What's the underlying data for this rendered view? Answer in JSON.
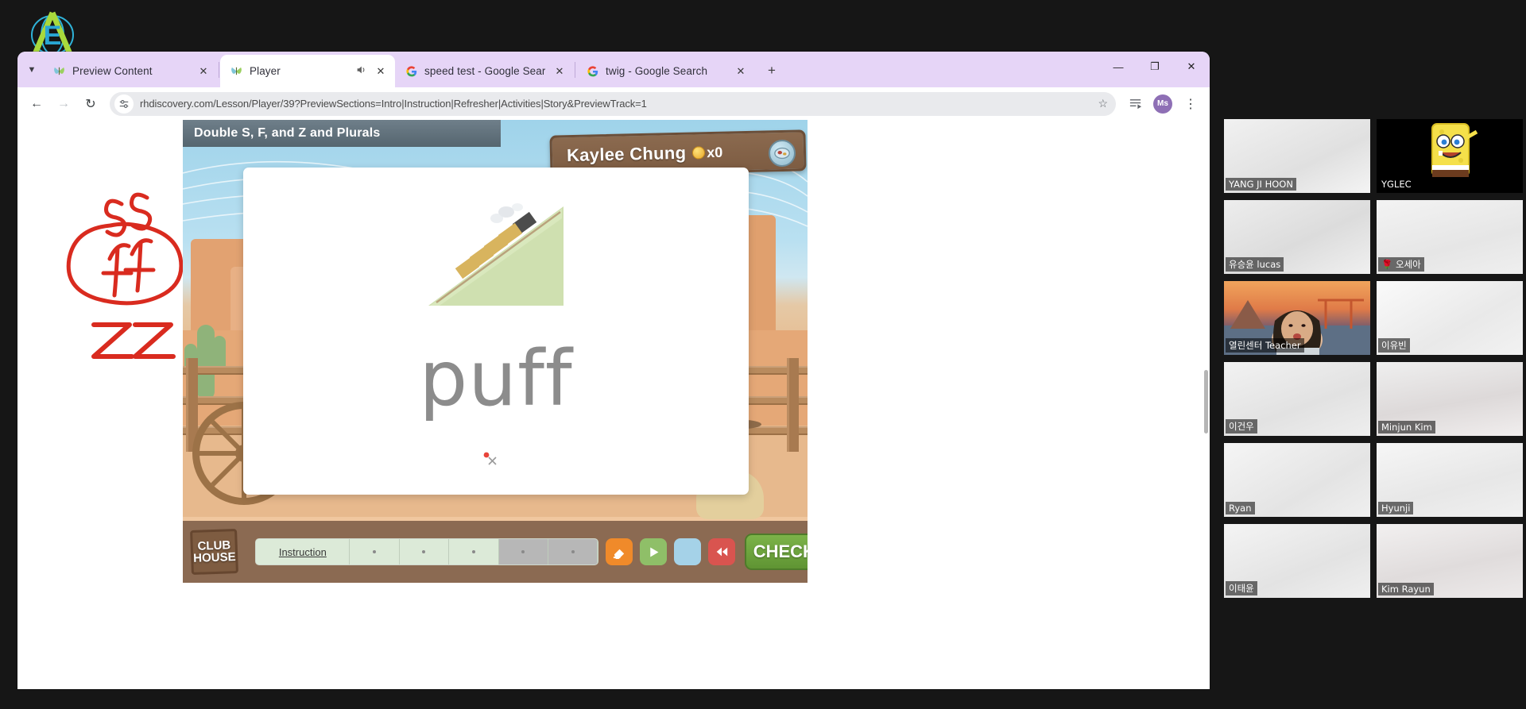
{
  "browser": {
    "tabs": [
      {
        "title": "Preview Content",
        "favicon": "butterfly-icon",
        "active": false,
        "audio": false
      },
      {
        "title": "Player",
        "favicon": "butterfly-icon",
        "active": true,
        "audio": true
      },
      {
        "title": "speed test - Google Search",
        "favicon": "google-icon",
        "active": false,
        "audio": false
      },
      {
        "title": "twig - Google Search",
        "favicon": "google-icon",
        "active": false,
        "audio": false
      }
    ],
    "new_tab_label": "+",
    "window_controls": {
      "minimize": "—",
      "maximize": "❐",
      "close": "✕"
    },
    "toolbar": {
      "back": "←",
      "forward": "→",
      "reload": "↻",
      "url": "rhdiscovery.com/Lesson/Player/39?PreviewSections=Intro|Instruction|Refresher|Activities|Story&PreviewTrack=1",
      "url_host": "rhdiscovery.com",
      "url_rest": "/Lesson/Player/39?PreviewSections=Intro|Instruction|Refresher|Activities|Story&PreviewTrack=1",
      "bookmark_icon": "star-icon",
      "reading_list_icon": "reading-list-icon",
      "menu_icon": "kebab-menu-icon",
      "profile_initials": "Ms"
    },
    "accent_tabstrip": "#e6d5f7"
  },
  "lesson": {
    "title": "Double S, F, and Z and Plurals",
    "student_name": "Kaylee Chung",
    "coin_count": "x0",
    "help_icon": "help-badge-icon",
    "card": {
      "word": "puff",
      "image_alt": "train-on-hill-illustration"
    },
    "controls": {
      "clubhouse_line1": "CLUB",
      "clubhouse_line2": "HOUSE",
      "progress_label": "Instruction",
      "progress_done": 3,
      "progress_total": 5,
      "buttons": [
        {
          "name": "eraser-button",
          "color": "#f08a2a",
          "icon": "eraser-icon"
        },
        {
          "name": "play-button",
          "color": "#8fbf68",
          "icon": "play-icon"
        },
        {
          "name": "blank-button",
          "color": "#a5d2e8",
          "icon": ""
        },
        {
          "name": "rewind-button",
          "color": "#d9544f",
          "icon": "rewind-icon"
        }
      ],
      "check_label": "CHECK",
      "check_icon": "checkmark-icon",
      "check_color": "#6fa83e"
    }
  },
  "annotation": {
    "strokes_alt": "red handwriting: ss, ff circled, zz",
    "color": "#d92b1f",
    "texts": [
      "ss",
      "ff",
      "zz"
    ]
  },
  "video_grid": {
    "participants": [
      {
        "name": "YANG JI HOON",
        "active": false,
        "avatar": false
      },
      {
        "name": "YGLEC",
        "active": false,
        "avatar": true,
        "avatar_alt": "spongebob-avatar"
      },
      {
        "name": "유승윤 lucas",
        "active": false,
        "avatar": false
      },
      {
        "name": "🌹 오세아",
        "active": false,
        "avatar": false
      },
      {
        "name": "열린센터 Teacher",
        "active": true,
        "avatar": false
      },
      {
        "name": "이유빈",
        "active": false,
        "avatar": false
      },
      {
        "name": "이건우",
        "active": false,
        "avatar": false
      },
      {
        "name": "Minjun Kim",
        "active": false,
        "avatar": false
      },
      {
        "name": "Ryan",
        "active": false,
        "avatar": false
      },
      {
        "name": "Hyunji",
        "active": false,
        "avatar": false
      },
      {
        "name": "이태윤",
        "active": false,
        "avatar": false
      },
      {
        "name": "Kim Rayun",
        "active": false,
        "avatar": false
      }
    ],
    "active_border_color": "#8ee03a"
  }
}
